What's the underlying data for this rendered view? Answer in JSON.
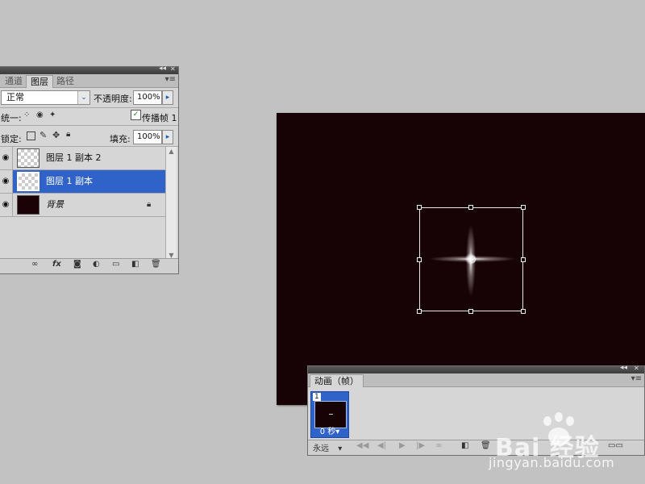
{
  "layers_panel": {
    "tabs": [
      {
        "label": "通道"
      },
      {
        "label": "图层"
      },
      {
        "label": "路径"
      }
    ],
    "blend_mode": "正常",
    "opacity_label": "不透明度:",
    "opacity_value": "100%",
    "unify_label": "统一:",
    "propagate_label": "传播帧 1",
    "lock_label": "锁定:",
    "fill_label": "填充:",
    "fill_value": "100%",
    "layers": [
      {
        "name": "图层 1 副本 2",
        "selected": false,
        "visible": true
      },
      {
        "name": "图层 1 副本",
        "selected": true,
        "visible": true
      },
      {
        "name": "背景",
        "selected": false,
        "visible": true,
        "locked": true
      }
    ]
  },
  "animation_panel": {
    "tab_label": "动画（帧）",
    "frames": [
      {
        "number": "1",
        "delay": "0 秒"
      }
    ],
    "loop_value": "永远"
  },
  "watermark": {
    "brand": "Bai 经验",
    "url": "jingyan.baidu.com"
  },
  "colors": {
    "canvas_background": "#170205",
    "selection_blue": "#3063c9",
    "workspace_gray": "#c2c2c2"
  }
}
